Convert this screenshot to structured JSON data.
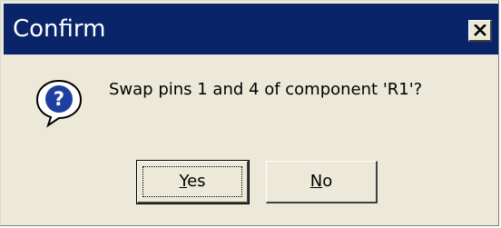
{
  "window": {
    "title": "Confirm"
  },
  "dialog": {
    "message": "Swap pins 1 and 4 of component 'R1'?",
    "icon": "question-icon",
    "buttons": [
      {
        "label": "Yes",
        "mnemonic": "Y",
        "rest": "es",
        "default": true
      },
      {
        "label": "No",
        "mnemonic": "N",
        "rest": "o",
        "default": false
      }
    ]
  },
  "colors": {
    "titlebar": "#0a246a",
    "dialog_bg": "#ece9d8",
    "icon_blue": "#1f3fa0"
  }
}
